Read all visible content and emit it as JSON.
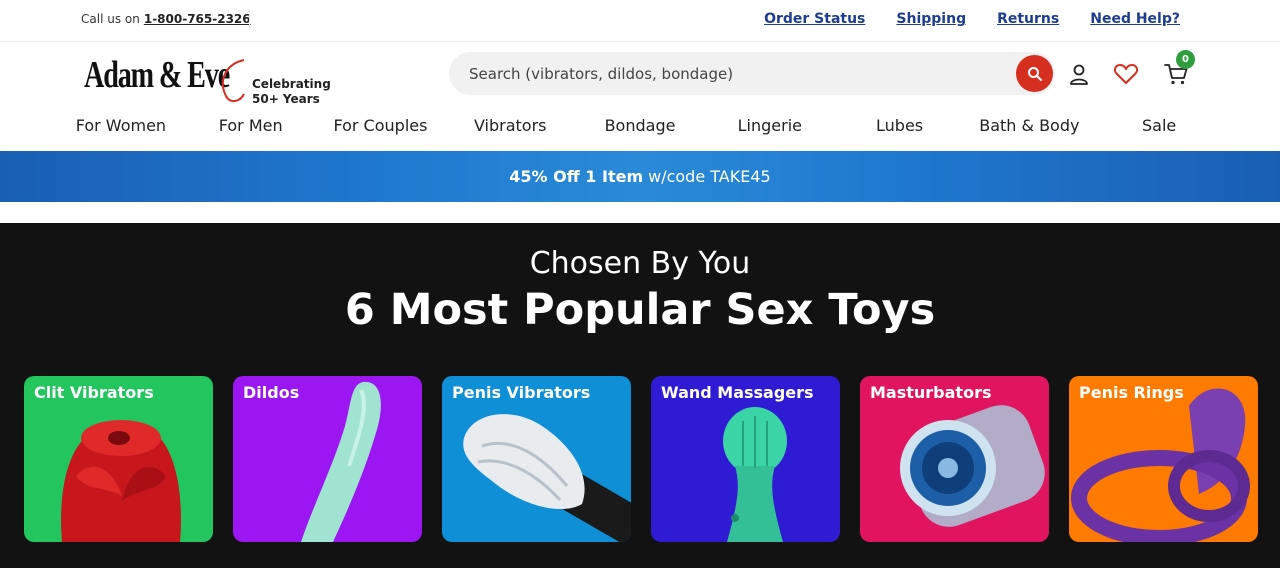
{
  "utility": {
    "call_label": "Call us on",
    "phone": "1-800-765-2326",
    "links": [
      "Order Status",
      "Shipping",
      "Returns",
      "Need Help?"
    ]
  },
  "header": {
    "logo_text": "Adam & Eve",
    "logo_tagline_1": "Celebrating",
    "logo_tagline_2": "50+ Years",
    "search_placeholder": "Search (vibrators, dildos, bondage)",
    "cart_count": "0",
    "icons": [
      "search-icon",
      "user-icon",
      "heart-icon",
      "cart-icon"
    ]
  },
  "nav": {
    "items": [
      "For Women",
      "For Men",
      "For Couples",
      "Vibrators",
      "Bondage",
      "Lingerie",
      "Lubes",
      "Bath & Body",
      "Sale"
    ]
  },
  "promo": {
    "strong_text": "45% Off 1 Item",
    "rest_text": "w/code TAKE45"
  },
  "hero": {
    "subtitle": "Chosen By You",
    "title": "6 Most Popular Sex Toys",
    "cards": [
      {
        "label": "Clit Vibrators",
        "color": "#22c55e"
      },
      {
        "label": "Dildos",
        "color": "#9b16f0"
      },
      {
        "label": "Penis Vibrators",
        "color": "#0f8fd6"
      },
      {
        "label": "Wand Massagers",
        "color": "#2f1bd4"
      },
      {
        "label": "Masturbators",
        "color": "#e0145f"
      },
      {
        "label": "Penis Rings",
        "color": "#ff7a00"
      }
    ]
  },
  "colors": {
    "link_blue": "#1f3d8f",
    "search_red": "#d62e1f",
    "cart_badge_green": "#2e9e3e",
    "hero_bg": "#121212"
  }
}
